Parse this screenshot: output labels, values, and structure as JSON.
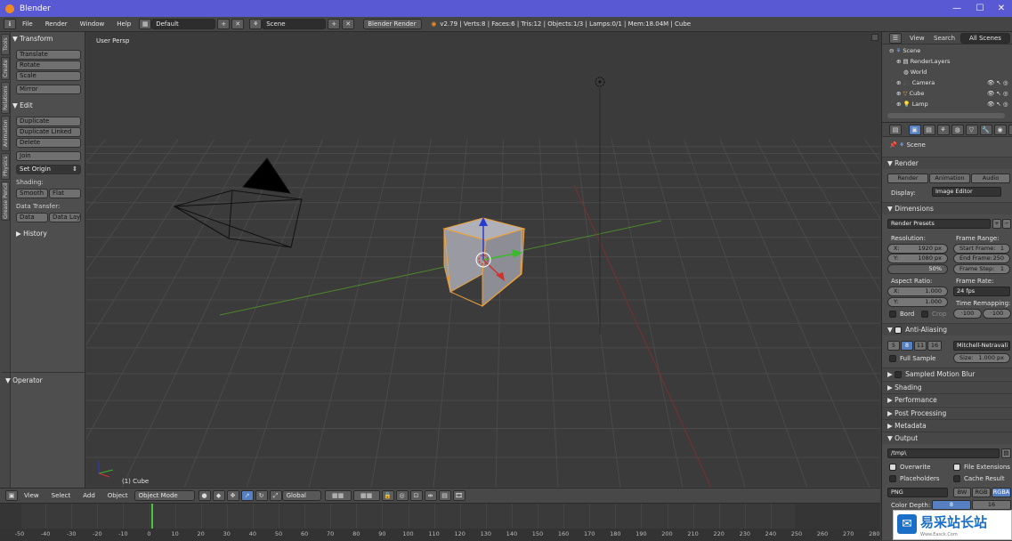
{
  "window": {
    "title": "Blender",
    "controls": [
      "—",
      "☐",
      "✕"
    ]
  },
  "infobar": {
    "menus": [
      "File",
      "Render",
      "Window",
      "Help"
    ],
    "layout": "Default",
    "scene": "Scene",
    "engine": "Blender Render",
    "stats": "v2.79 | Verts:8 | Faces:6 | Tris:12 | Objects:1/3 | Lamps:0/1 | Mem:18.04M | Cube"
  },
  "toolshelf": {
    "tabs": [
      "Tools",
      "Create",
      "Relations",
      "Animation",
      "Physics",
      "Grease Pencil"
    ],
    "transform": {
      "title": "▼ Transform",
      "buttons": [
        "Translate",
        "Rotate",
        "Scale",
        "Mirror"
      ]
    },
    "edit": {
      "title": "▼ Edit",
      "buttons": [
        "Duplicate",
        "Duplicate Linked",
        "Delete",
        "Join"
      ],
      "set_origin": "Set Origin"
    },
    "shading": {
      "label": "Shading:",
      "smooth": "Smooth",
      "flat": "Flat"
    },
    "data_transfer": {
      "label": "Data Transfer:",
      "data": "Data",
      "data_layout": "Data Layo"
    },
    "history": "▶ History",
    "operator": "▼ Operator"
  },
  "viewport": {
    "view_label": "User Persp",
    "object_label": "(1) Cube"
  },
  "view3d_header": {
    "menus": [
      "View",
      "Select",
      "Add",
      "Object"
    ],
    "mode": "Object Mode",
    "orientation": "Global"
  },
  "timeline": {
    "ticks": [
      "-50",
      "-40",
      "-30",
      "-20",
      "-10",
      "0",
      "10",
      "20",
      "30",
      "40",
      "50",
      "60",
      "70",
      "80",
      "90",
      "100",
      "110",
      "120",
      "130",
      "140",
      "150",
      "160",
      "170",
      "180",
      "190",
      "200",
      "210",
      "220",
      "230",
      "240",
      "250",
      "260",
      "270",
      "280"
    ],
    "current_frame": 1
  },
  "outliner": {
    "menus": [
      "View",
      "Search"
    ],
    "filter": "All Scenes",
    "items": [
      "Scene",
      "RenderLayers",
      "World",
      "Camera",
      "Cube",
      "Lamp"
    ]
  },
  "properties": {
    "context": "Scene",
    "render": {
      "title": "▼ Render",
      "render": "Render",
      "animation": "Animation",
      "audio": "Audio",
      "display_label": "Display:",
      "display": "Image Editor"
    },
    "dimensions": {
      "title": "▼ Dimensions",
      "presets": "Render Presets",
      "resolution_label": "Resolution:",
      "res_x": "X:",
      "res_x_val": "1920 px",
      "res_y": "Y:",
      "res_y_val": "1080 px",
      "res_pct": "50%",
      "frame_range_label": "Frame Range:",
      "start_frame": "Start Frame:",
      "start_val": "1",
      "end_frame": "End Frame:",
      "end_val": "250",
      "frame_step": "Frame Step:",
      "step_val": "1",
      "aspect_label": "Aspect Ratio:",
      "asp_x": "X:",
      "asp_x_val": "1.000",
      "asp_y": "Y:",
      "asp_y_val": "1.000",
      "frame_rate_label": "Frame Rate:",
      "frame_rate": "24 fps",
      "time_remap_label": "Time Remapping:",
      "remap_old": "·100",
      "remap_new": "·100",
      "bord": "Bord",
      "crop": "Crop"
    },
    "anti_aliasing": {
      "title": "Anti-Aliasing",
      "samples": [
        "5",
        "8",
        "11",
        "16"
      ],
      "selected": "8",
      "filter": "Mitchell-Netravali",
      "full_sample": "Full Sample",
      "size_label": "Size:",
      "size_val": "1.000 px"
    },
    "collapsed": [
      "Sampled Motion Blur",
      "▶ Shading",
      "▶ Performance",
      "▶ Post Processing",
      "▶ Metadata"
    ],
    "output": {
      "title": "▼ Output",
      "path": "/tmp\\",
      "overwrite": "Overwrite",
      "file_extensions": "File Extensions",
      "placeholders": "Placeholders",
      "cache_result": "Cache Result",
      "format": "PNG",
      "bw": "BW",
      "rgb": "RGB",
      "rgba": "RGBA",
      "color_depth_label": "Color Depth:",
      "depth_8": "8",
      "depth_16": "16"
    }
  },
  "watermark": {
    "text": "易采站长站",
    "sub": "Www.Easck.Com"
  },
  "colors": {
    "selection": "#f0a13a",
    "x_axis": "#8a3434",
    "y_axis": "#4a8a2a",
    "accent": "#5680c2"
  }
}
